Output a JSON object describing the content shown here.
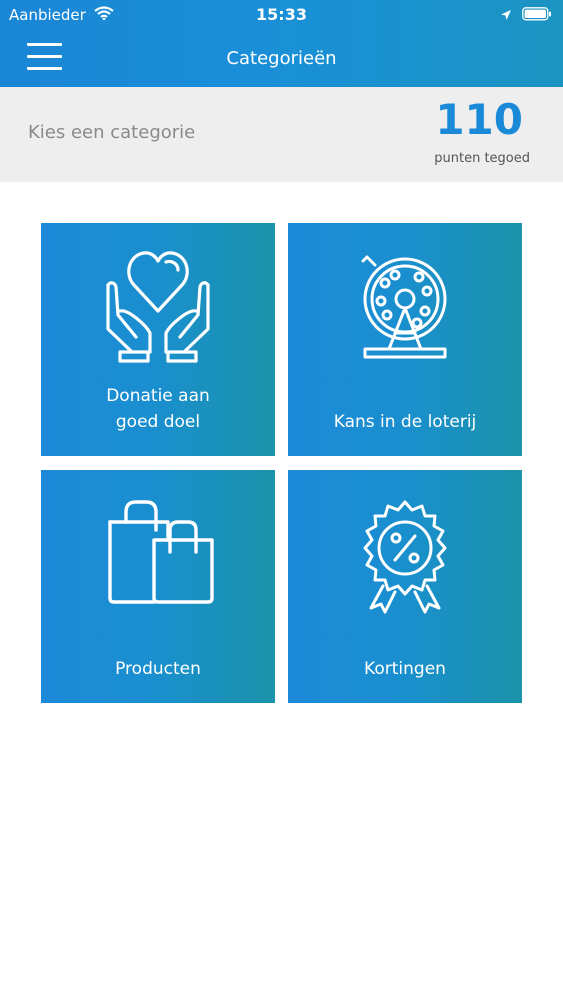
{
  "status_bar": {
    "carrier": "Aanbieder",
    "time": "15:33"
  },
  "nav": {
    "title": "Categorieën"
  },
  "subheader": {
    "prompt": "Kies een categorie",
    "points_value": "110",
    "points_label": "punten tegoed"
  },
  "categories": [
    {
      "label_line1": "Donatie aan",
      "label_line2": "goed doel",
      "icon": "heart-hands-icon"
    },
    {
      "label": "Kans in de loterij",
      "icon": "lottery-drum-icon"
    },
    {
      "label": "Producten",
      "icon": "shopping-bags-icon"
    },
    {
      "label": "Kortingen",
      "icon": "discount-badge-icon"
    }
  ],
  "colors": {
    "brand_blue": "#1a8ad8",
    "tile_gradient_end": "#1b93a9"
  }
}
